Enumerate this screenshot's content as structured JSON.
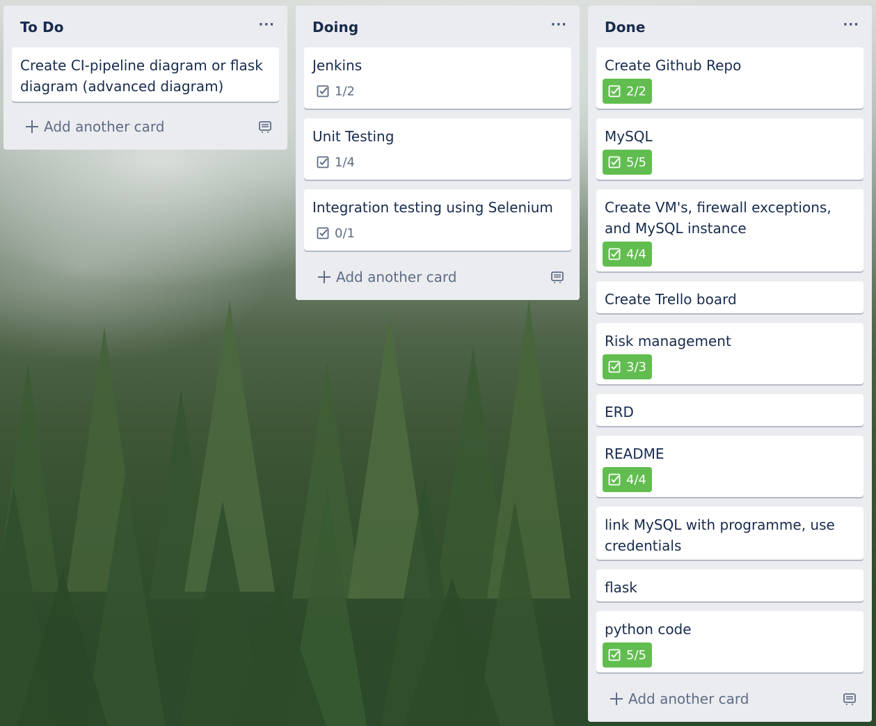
{
  "lists": [
    {
      "title": "To Do",
      "menu_label": "···",
      "add_label": "Add another card",
      "cards": [
        {
          "title": "Create CI-pipeline diagram or flask diagram (advanced diagram)"
        }
      ]
    },
    {
      "title": "Doing",
      "menu_label": "···",
      "add_label": "Add another card",
      "cards": [
        {
          "title": "Jenkins",
          "checklist": "1/2",
          "complete": false
        },
        {
          "title": "Unit Testing",
          "checklist": "1/4",
          "complete": false
        },
        {
          "title": "Integration testing using Selenium",
          "checklist": "0/1",
          "complete": false
        }
      ]
    },
    {
      "title": "Done",
      "menu_label": "···",
      "add_label": "Add another card",
      "cards": [
        {
          "title": "Create Github Repo",
          "checklist": "2/2",
          "complete": true
        },
        {
          "title": "MySQL",
          "checklist": "5/5",
          "complete": true
        },
        {
          "title": "Create VM's, firewall exceptions, and MySQL instance",
          "checklist": "4/4",
          "complete": true
        },
        {
          "title": "Create Trello board"
        },
        {
          "title": "Risk management",
          "checklist": "3/3",
          "complete": true
        },
        {
          "title": "ERD"
        },
        {
          "title": "README",
          "checklist": "4/4",
          "complete": true
        },
        {
          "title": "link MySQL with programme, use credentials"
        },
        {
          "title": "flask"
        },
        {
          "title": "python code",
          "checklist": "5/5",
          "complete": true
        }
      ]
    }
  ],
  "colors": {
    "list_bg": "#ebecf0",
    "card_bg": "#ffffff",
    "complete_badge": "#61bd4f",
    "text_primary": "#172b4d",
    "text_muted": "#5e6c84"
  },
  "icons": {
    "checklist": "checkbox-icon",
    "add": "plus-icon",
    "template": "card-template-icon",
    "menu": "more-icon"
  }
}
